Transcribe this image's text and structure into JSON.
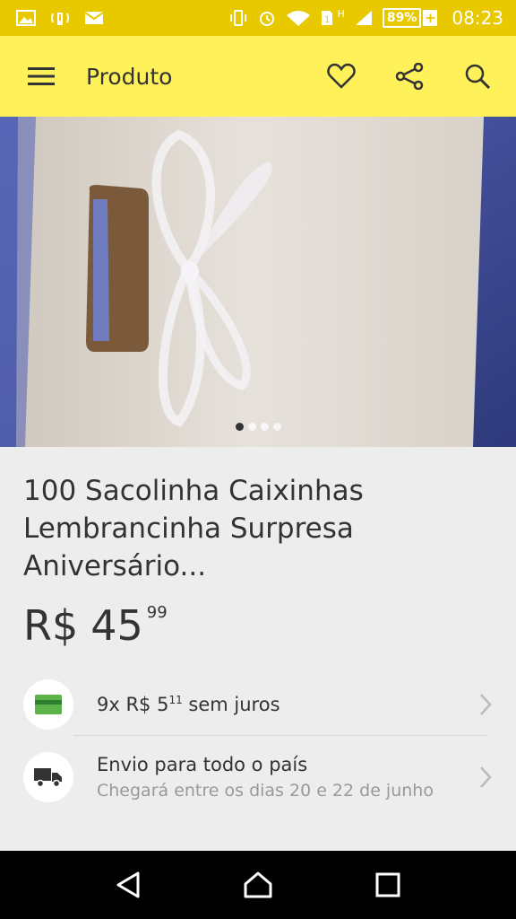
{
  "status_bar": {
    "battery": "89%",
    "battery_charging": "+",
    "time": "08:23",
    "icons": [
      "image-icon",
      "signal-alert-icon",
      "mail-icon",
      "vibrate-icon",
      "alarm-icon",
      "wifi-icon",
      "sim-icon",
      "cell-signal-icon"
    ],
    "network": "H"
  },
  "toolbar": {
    "title": "Produto",
    "icons": [
      "menu-icon",
      "heart-icon",
      "share-icon",
      "search-icon"
    ],
    "bg_color": "#fff159"
  },
  "gallery": {
    "image": "white gift bag with ribbon",
    "page_count": 4,
    "active_index": 0
  },
  "product": {
    "title": "100 Sacolinha Caixinhas Lembrancinha Surpresa Aniversário...",
    "price_currency": "R$",
    "price_integer": "45",
    "price_cents": "99"
  },
  "installments": {
    "prefix": "9x R$ 5",
    "cents": "11",
    "suffix": "sem juros",
    "icon": "credit-card-icon"
  },
  "shipping": {
    "title": "Envio para todo o país",
    "subtitle": "Chegará entre os dias 20 e 22 de junho",
    "icon": "truck-icon"
  },
  "nav_bar": {
    "icons": [
      "back-icon",
      "home-icon",
      "recents-icon"
    ]
  }
}
